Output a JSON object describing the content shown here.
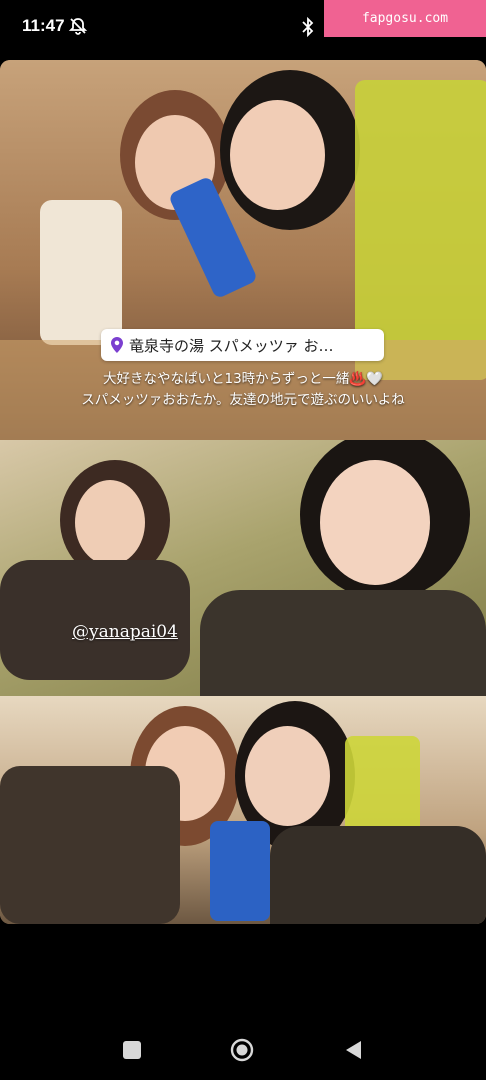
{
  "status_bar": {
    "time": "11:47",
    "icons": [
      "mute-notifications-icon",
      "bluetooth-icon"
    ]
  },
  "watermark": {
    "text": "fapgosu.com"
  },
  "story": {
    "location": "竜泉寺の湯 スパメッツァ お…",
    "caption_lines": [
      "大好きなやなぱいと13時からずっと一緒♨️🤍",
      "スパメッツァおおたか。友達の地元で遊ぶのいいよね"
    ],
    "mention": "@yanapai04",
    "photos": [
      {
        "content": "two-women-selfie-with-drinks"
      },
      {
        "content": "two-women-lying-on-floor-peace-sign"
      },
      {
        "content": "two-women-toasting-drinks"
      }
    ]
  },
  "nav_bar": {
    "buttons": [
      "recents-square-icon",
      "home-circle-icon",
      "back-triangle-icon"
    ]
  },
  "colors": {
    "background": "#000000",
    "watermark": "#f06292",
    "sticker": "#ffffff"
  }
}
